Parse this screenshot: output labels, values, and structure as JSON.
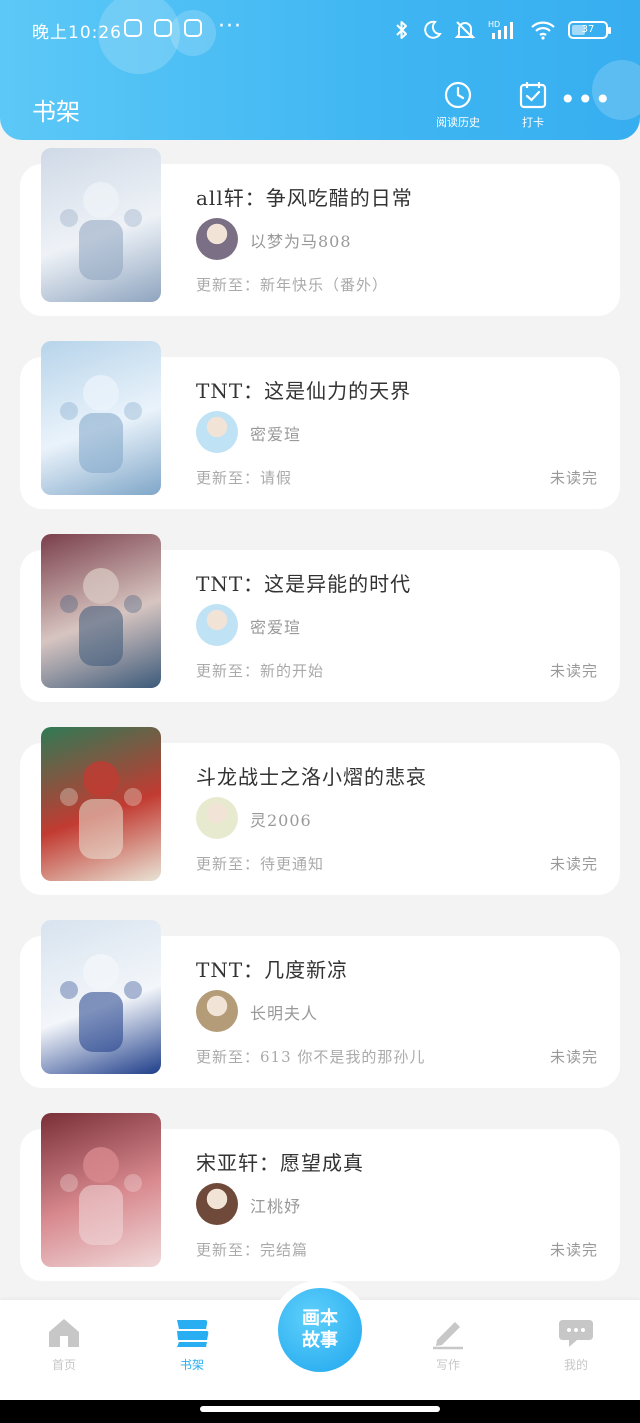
{
  "status_bar": {
    "time": "晚上10:26",
    "more": "···",
    "battery": "37",
    "battery_level": 0.37
  },
  "header": {
    "title": "书架",
    "history_label": "阅读历史",
    "checkin_label": "打卡",
    "more": "•••"
  },
  "books": [
    {
      "title": "all轩：争风吃醋的日常",
      "author": "以梦为马808",
      "update": "更新至：新年快乐（番外）",
      "status": "",
      "cover_colors": [
        "#cfd9e6",
        "#eef2f7",
        "#8ea4bf"
      ],
      "avatar_color": "#7a6f84"
    },
    {
      "title": "TNT：这是仙力的天界",
      "author": "密爱瑄",
      "update": "更新至：请假",
      "status": "未读完",
      "cover_colors": [
        "#b7d4ea",
        "#eaf3fb",
        "#7fa6c8"
      ],
      "avatar_color": "#bfe2f5"
    },
    {
      "title": "TNT：这是异能的时代",
      "author": "密爱瑄",
      "update": "更新至：新的开始",
      "status": "未读完",
      "cover_colors": [
        "#7a3f4b",
        "#d7c5c1",
        "#3c5a7a"
      ],
      "avatar_color": "#bfe2f5"
    },
    {
      "title": "斗龙战士之洛小熠的悲哀",
      "author": "灵2006",
      "update": "更新至：待更通知",
      "status": "未读完",
      "cover_colors": [
        "#2f7a55",
        "#c23b32",
        "#e9e4d6"
      ],
      "avatar_color": "#e8ead0"
    },
    {
      "title": "TNT：几度新凉",
      "author": "长明夫人",
      "update": "更新至：613 你不是我的那孙儿",
      "status": "未读完",
      "cover_colors": [
        "#d7e3ef",
        "#f3f6fa",
        "#1f3e8a"
      ],
      "avatar_color": "#b59c78"
    },
    {
      "title": "宋亚轩：愿望成真",
      "author": "江桃妤",
      "update": "更新至：完结篇",
      "status": "未读完",
      "cover_colors": [
        "#7a2f38",
        "#d88a8f",
        "#f0d9da"
      ],
      "avatar_color": "#6f4a3a"
    }
  ],
  "tabbar": {
    "home": "首页",
    "shelf": "书架",
    "center_line1": "画本",
    "center_line2": "故事",
    "write": "写作",
    "me": "我的",
    "active_color": "#2aaef2",
    "inactive_color": "#c7c7c7"
  }
}
